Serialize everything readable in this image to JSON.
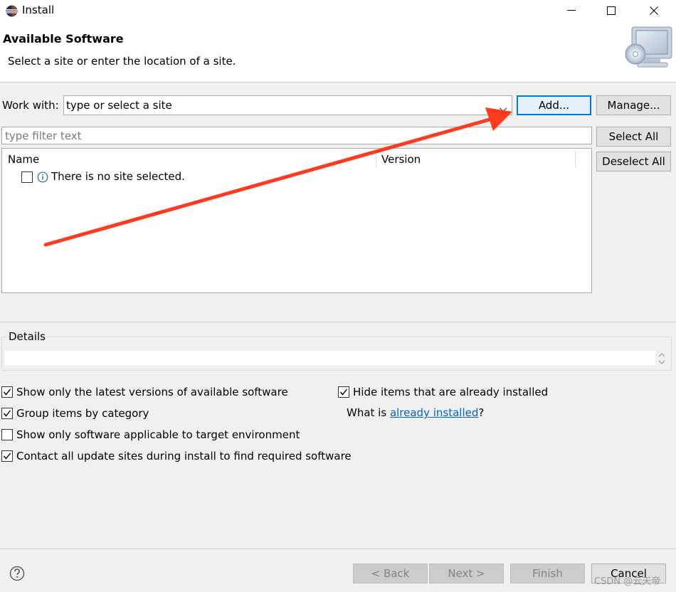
{
  "window": {
    "title": "Install",
    "app_icon": "eclipse-icon",
    "controls": [
      "minimize-icon",
      "maximize-icon",
      "close-icon"
    ]
  },
  "header": {
    "title": "Available Software",
    "description": "Select a site or enter the location of a site.",
    "graphic": "monitor-cd-icon"
  },
  "work_with": {
    "label": "Work with:",
    "value": "type or select a site",
    "add_label": "Add...",
    "manage_label": "Manage..."
  },
  "filter": {
    "placeholder": "type filter text",
    "select_all_label": "Select All",
    "deselect_all_label": "Deselect All"
  },
  "tree": {
    "columns": [
      "Name",
      "Version"
    ],
    "rows": [
      {
        "label": "There is no site selected.",
        "checked": false,
        "icon": "info-icon"
      }
    ]
  },
  "details": {
    "label": "Details",
    "text": ""
  },
  "options": {
    "latest": {
      "label": "Show only the latest versions of available software",
      "checked": true
    },
    "group": {
      "label": "Group items by category",
      "checked": true
    },
    "applicable": {
      "label": "Show only software applicable to target environment",
      "checked": false
    },
    "contact": {
      "label": "Contact all update sites during install to find required software",
      "checked": true
    },
    "hide_installed": {
      "label": "Hide items that are already installed",
      "checked": true
    },
    "what_is_prefix": "What is ",
    "what_is_link": "already installed",
    "what_is_suffix": "?"
  },
  "footer": {
    "help_icon": "help-icon",
    "back_label": "< Back",
    "next_label": "Next >",
    "finish_label": "Finish",
    "cancel_label": "Cancel"
  },
  "watermark": "CSDN @云天帝",
  "colors": {
    "annotation_arrow": "#ff3b1f",
    "link": "#0066cc",
    "focus": "#0078d7"
  }
}
